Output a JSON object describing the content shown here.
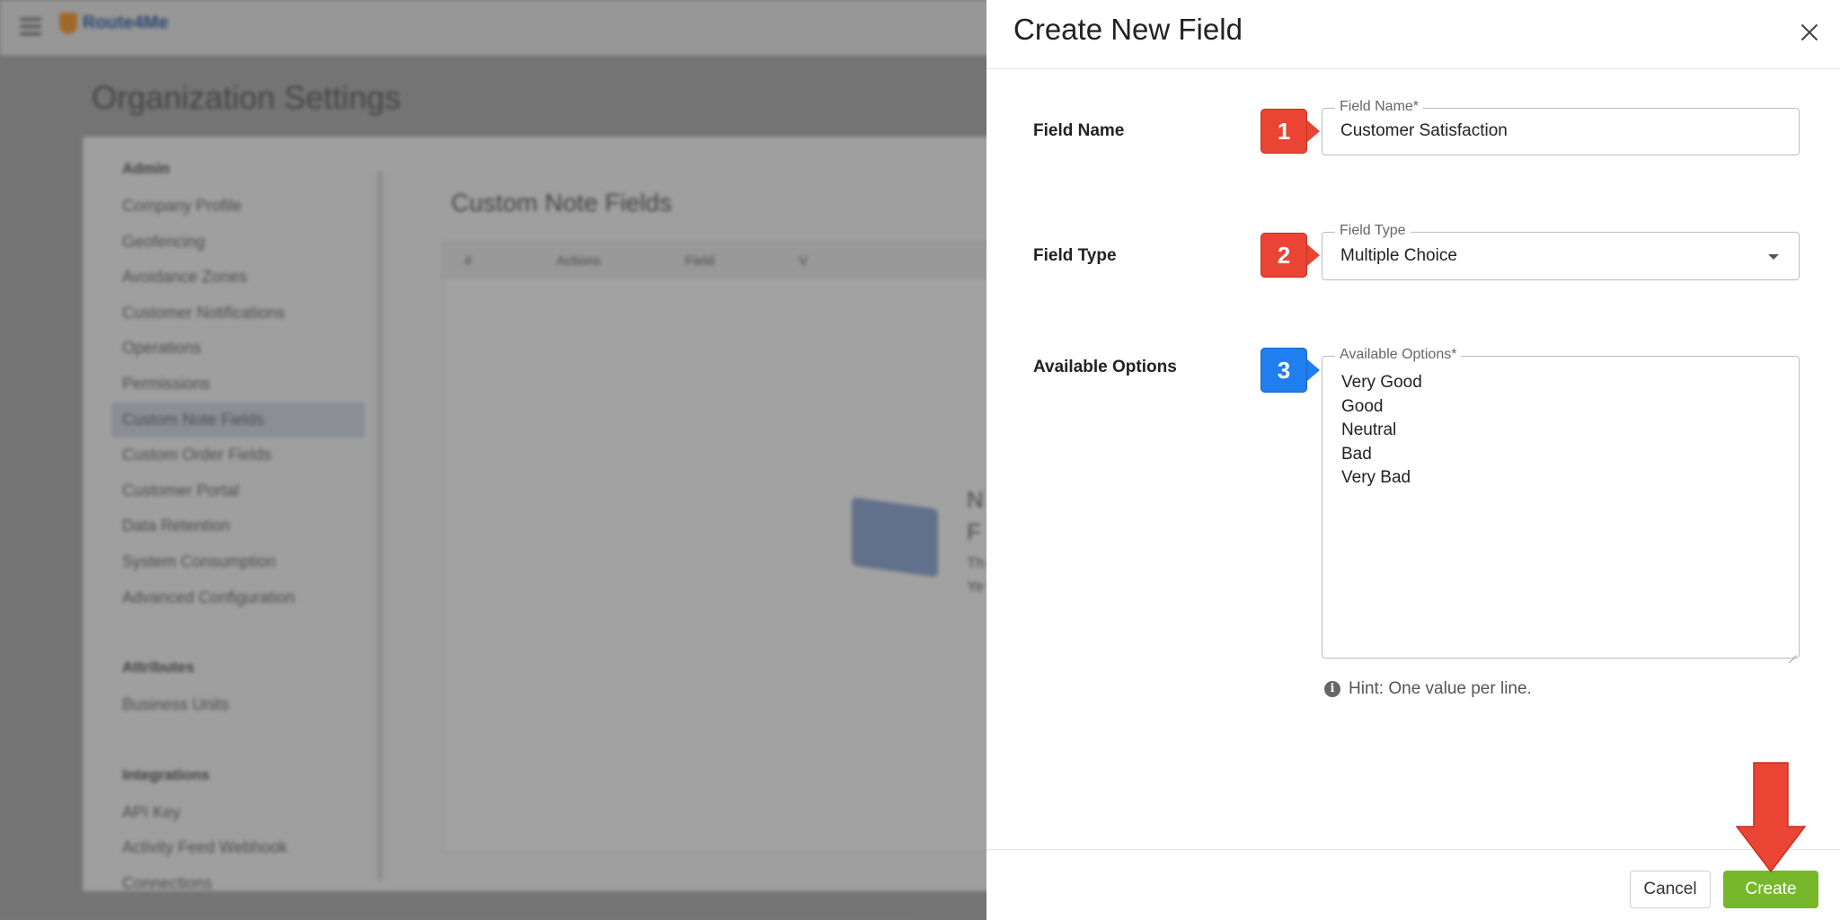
{
  "background": {
    "logo_text": "Route4Me",
    "page_title": "Organization Settings",
    "nav_groups": [
      {
        "heading": "Admin",
        "items": [
          "Company Profile",
          "Geofencing",
          "Avoidance Zones",
          "Customer Notifications",
          "Operations",
          "Permissions",
          "Custom Note Fields",
          "Custom Order Fields",
          "Customer Portal",
          "Data Retention",
          "System Consumption",
          "Advanced Configuration"
        ],
        "active_index": 6
      },
      {
        "heading": "Attributes",
        "items": [
          "Business Units"
        ]
      },
      {
        "heading": "Integrations",
        "items": [
          "API Key",
          "Activity Feed Webhook",
          "Connections"
        ]
      }
    ],
    "section_title": "Custom Note Fields",
    "table_headers": [
      "#",
      "Actions",
      "Field",
      "V"
    ],
    "empty_text_line1": "N",
    "empty_text_line2": "F",
    "empty_text_line3": "Th",
    "empty_text_line4": "Ye"
  },
  "panel": {
    "title": "Create New Field",
    "field_name": {
      "row_label": "Field Name",
      "legend": "Field Name*",
      "value": "Customer Satisfaction",
      "badge": "1"
    },
    "field_type": {
      "row_label": "Field Type",
      "legend": "Field Type",
      "value": "Multiple Choice",
      "badge": "2"
    },
    "available_options": {
      "row_label": "Available Options",
      "legend": "Available Options*",
      "options": [
        "Very Good",
        "Good",
        "Neutral",
        "Bad",
        "Very Bad"
      ],
      "badge": "3",
      "hint": "Hint: One value per line."
    },
    "footer": {
      "cancel_label": "Cancel",
      "create_label": "Create"
    }
  },
  "colors": {
    "step_red": "#e94434",
    "step_blue": "#1f7ef0",
    "create_green": "#76b82a",
    "callout_arrow": "#e94434"
  },
  "icons": {
    "menu": "hamburger-icon",
    "close": "close-icon",
    "dropdown": "chevron-down-icon",
    "info": "info-icon",
    "annotation": "down-arrow-icon"
  }
}
